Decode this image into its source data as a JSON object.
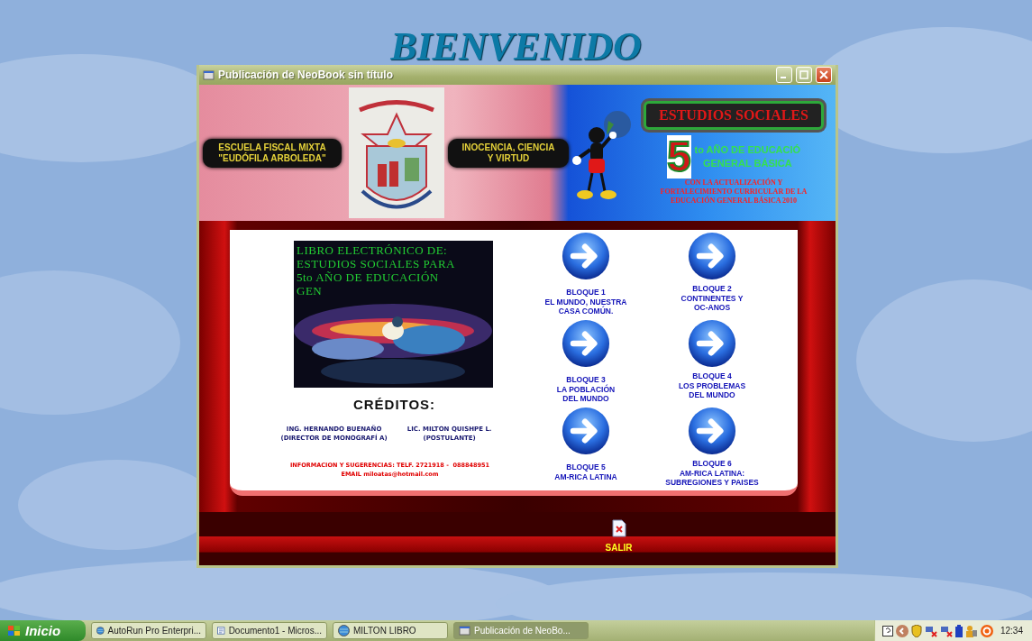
{
  "heading": "BIENVENIDO",
  "window": {
    "title": "Publicación de NeoBook sin título"
  },
  "banner": {
    "school": "ESCUELA FISCAL MIXTA\n\"EUDÓFILA ARBOLEDA\"",
    "motto": "INOCENCIA, CIENCIA\nY VIRTUD",
    "subject": "ESTUDIOS SOCIALES",
    "grade_number": "5",
    "grade_text": "to AÑO DE EDUCACIÓ\nGENERAL BÁSICA",
    "note": "CON LA ACTUALIZACIÓN Y\nFORTALECIMIENTO CURRICULAR DE LA\nEDUCACIÓN GENERAL BÁSICA 2010"
  },
  "cover": {
    "kind": "picture",
    "caption": "LIBRO ELECTRÓNICO DE:\nESTUDIOS SOCIALES PARA\n5to AÑO DE EDUCACIÓN\nGEN"
  },
  "credits": {
    "title": "CRÉDITOS:",
    "people": [
      "ING. HERNANDO BUENAÑO\n(DIRECTOR DE MONOGRAFÍ A)",
      "LIC. MILTON QUISHPE L.\n(POSTULANTE)"
    ],
    "contact": "INFORMACION Y SUGERENCIAS: TELF. 2721918 -  088848951\nEMAIL miloatas@hotmail.com"
  },
  "blocks": [
    {
      "label": "BLOQUE 1\nEL MUNDO, NUESTRA\nCASA COMÚN."
    },
    {
      "label": "BLOQUE 2\nCONTINENTES Y\nOC-ANOS"
    },
    {
      "label": "BLOQUE 3\nLA POBLACIÓN\nDEL MUNDO"
    },
    {
      "label": "BLOQUE 4\nLOS PROBLEMAS\nDEL MUNDO"
    },
    {
      "label": "BLOQUE 5\nAM-RICA LATINA"
    },
    {
      "label": "BLOQUE 6\nAM-RICA LATINA:\nSUBREGIONES Y PAISES"
    }
  ],
  "exit": {
    "label": "SALIR"
  },
  "taskbar": {
    "start": "Inicio",
    "tasks": [
      {
        "label": "AutoRun Pro Enterpri...",
        "kind": "globe",
        "selected": false
      },
      {
        "label": "Documento1 - Micros...",
        "kind": "document",
        "selected": false
      },
      {
        "label": "MILTON LIBRO",
        "kind": "globe",
        "selected": false
      },
      {
        "label": "Publicación de NeoBo...",
        "kind": "window",
        "selected": true
      }
    ],
    "clock": "12:34"
  }
}
